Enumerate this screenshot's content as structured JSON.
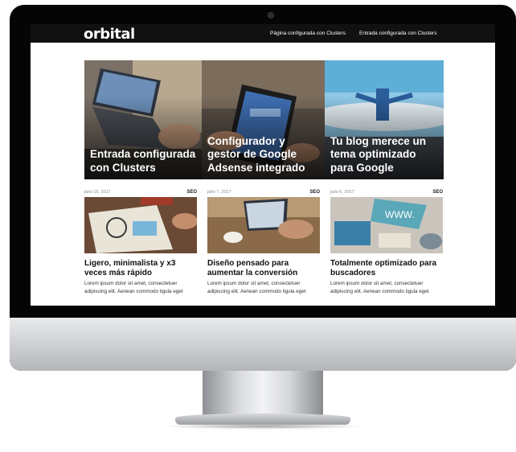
{
  "site": {
    "logo": "orbital",
    "nav": [
      "Página configurada con Clusters",
      "Entrada configurada con Clusters"
    ]
  },
  "featured": [
    {
      "title": "Entrada configurada con Clusters"
    },
    {
      "title": "Configurador y gestor de Google Adsense integrado"
    },
    {
      "title": "Tu blog merece un tema optimizado para Google"
    }
  ],
  "posts": [
    {
      "date": "julio 15, 2017",
      "category": "SEO",
      "title": "Ligero, minimalista y x3 veces más rápido",
      "excerpt": "Lorem ipsum dolor sit amet, consectetuer adipiscing elit. Aenean commodo ligula eget"
    },
    {
      "date": "julio 7, 2017",
      "category": "SEO",
      "title": "Diseño pensado para aumentar la conversión",
      "excerpt": "Lorem ipsum dolor sit amet, consectetuer adipiscing elit. Aenean commodo ligula eget"
    },
    {
      "date": "julio 6, 2017",
      "category": "SEO",
      "title": "Totalmente optimizado para buscadores",
      "excerpt": "Lorem ipsum dolor sit amet, consectetuer adipiscing elit. Aenean commodo ligula eget"
    }
  ],
  "colors": {
    "topbar": "#111111",
    "overlay_text": "#ffffff",
    "bezel": "#050505"
  }
}
